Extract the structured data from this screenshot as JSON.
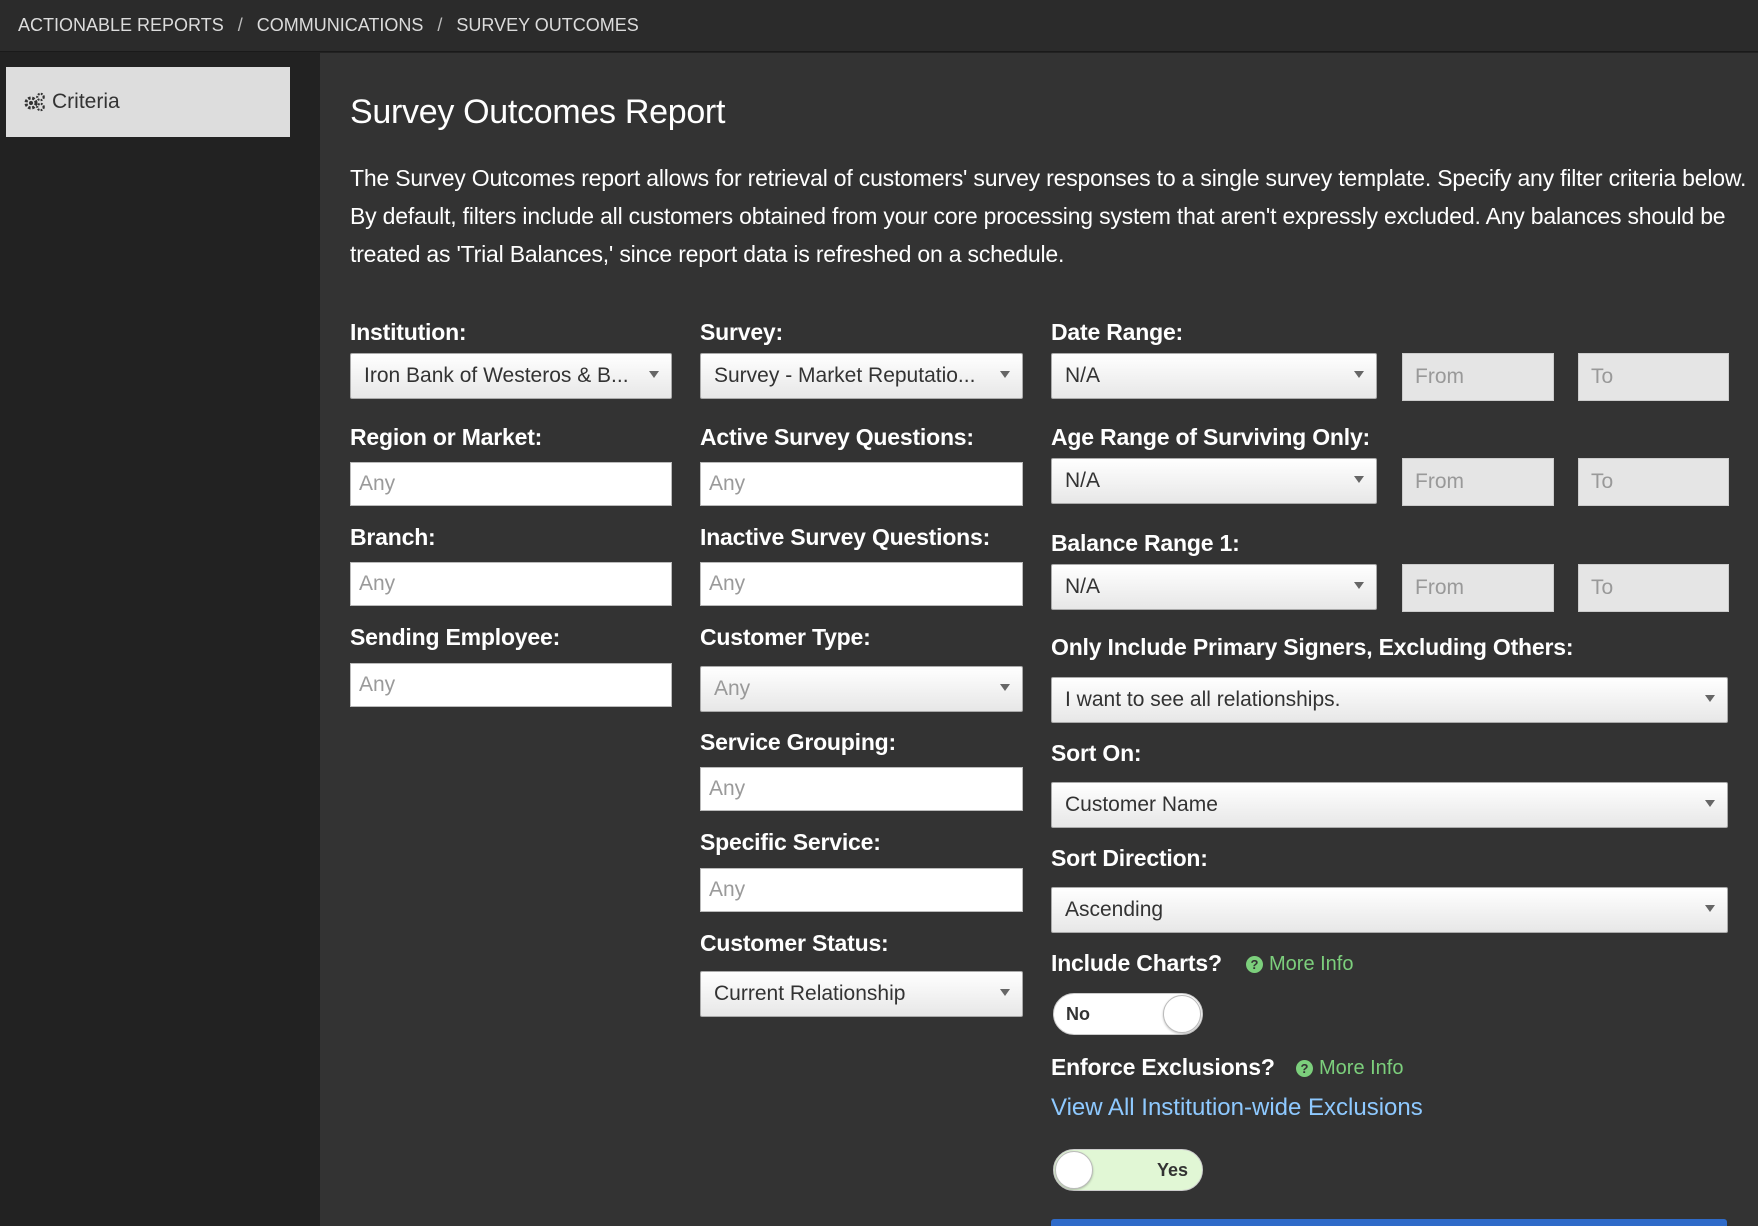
{
  "breadcrumb": [
    "ACTIONABLE REPORTS",
    "COMMUNICATIONS",
    "SURVEY OUTCOMES"
  ],
  "breadcrumb_separator": "/",
  "sidebar": {
    "criteria_label": "Criteria",
    "criteria_icon": "gears-icon"
  },
  "page": {
    "title": "Survey Outcomes Report",
    "description": "The Survey Outcomes report allows for retrieval of customers' survey responses to a single survey template. Specify any filter criteria below. By default, filters include all customers obtained from your core processing system that aren't expressly excluded. Any balances should be treated as 'Trial Balances,' since report data is refreshed on a schedule."
  },
  "form": {
    "institution": {
      "label": "Institution:",
      "value": "Iron Bank of Westeros & B..."
    },
    "region": {
      "label": "Region or Market:",
      "placeholder": "Any"
    },
    "branch": {
      "label": "Branch:",
      "placeholder": "Any"
    },
    "sending_employee": {
      "label": "Sending Employee:",
      "placeholder": "Any"
    },
    "survey": {
      "label": "Survey:",
      "value": "Survey - Market Reputatio..."
    },
    "active_questions": {
      "label": "Active Survey Questions:",
      "placeholder": "Any"
    },
    "inactive_questions": {
      "label": "Inactive Survey Questions:",
      "placeholder": "Any"
    },
    "customer_type": {
      "label": "Customer Type:",
      "value": "Any"
    },
    "service_grouping": {
      "label": "Service Grouping:",
      "placeholder": "Any"
    },
    "specific_service": {
      "label": "Specific Service:",
      "placeholder": "Any"
    },
    "customer_status": {
      "label": "Customer Status:",
      "value": "Current Relationship"
    },
    "date_range": {
      "label": "Date Range:",
      "value": "N/A",
      "from": "From",
      "to": "To"
    },
    "age_range": {
      "label": "Age Range of Surviving Only:",
      "value": "N/A",
      "from": "From",
      "to": "To"
    },
    "balance_range": {
      "label": "Balance Range 1:",
      "value": "N/A",
      "from": "From",
      "to": "To"
    },
    "primary_signers": {
      "label": "Only Include Primary Signers, Excluding Others:",
      "value": "I want to see all relationships."
    },
    "sort_on": {
      "label": "Sort On:",
      "value": "Customer Name"
    },
    "sort_direction": {
      "label": "Sort Direction:",
      "value": "Ascending"
    },
    "include_charts": {
      "label": "Include Charts?",
      "more_info": "More Info",
      "toggle_label": "No",
      "state": false
    },
    "enforce_exclusions": {
      "label": "Enforce Exclusions?",
      "more_info": "More Info",
      "link": "View All Institution-wide Exclusions",
      "toggle_label": "Yes",
      "state": true
    }
  },
  "colors": {
    "accent_green": "#7ccf7c",
    "link_blue": "#8ec9ff",
    "run_button": "#2f6bc9"
  }
}
